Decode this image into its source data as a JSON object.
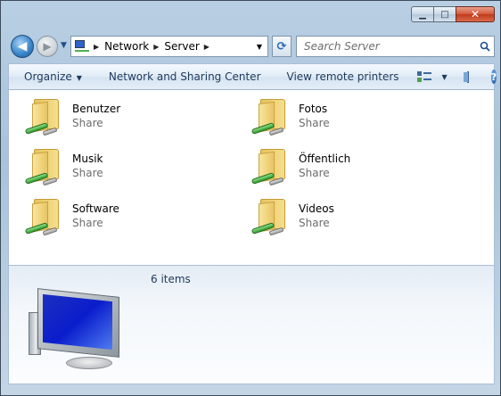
{
  "window": {
    "caption": {
      "minimize": "▁",
      "maximize": "□",
      "close": "✕"
    }
  },
  "nav": {
    "back_glyph": "◀",
    "forward_glyph": "▶",
    "address": {
      "crumbs": [
        "Network",
        "Server"
      ],
      "separator": "▶",
      "dropdown": "▼"
    },
    "refresh_glyph": "⟳",
    "search": {
      "placeholder": "Search Server",
      "value": ""
    }
  },
  "toolbar": {
    "organize": "Organize",
    "network_sharing": "Network and Sharing Center",
    "remote_printers": "View remote printers",
    "caret": "▼",
    "help": "?"
  },
  "items": [
    {
      "name": "Benutzer",
      "type": "Share"
    },
    {
      "name": "Fotos",
      "type": "Share"
    },
    {
      "name": "Musik",
      "type": "Share"
    },
    {
      "name": "Öffentlich",
      "type": "Share"
    },
    {
      "name": "Software",
      "type": "Share"
    },
    {
      "name": "Videos",
      "type": "Share"
    }
  ],
  "details": {
    "count": "6 items"
  },
  "colors": {
    "accent": "#2e63c9",
    "toolbar_text": "#1e395b",
    "subtext": "#6d6d6d"
  }
}
